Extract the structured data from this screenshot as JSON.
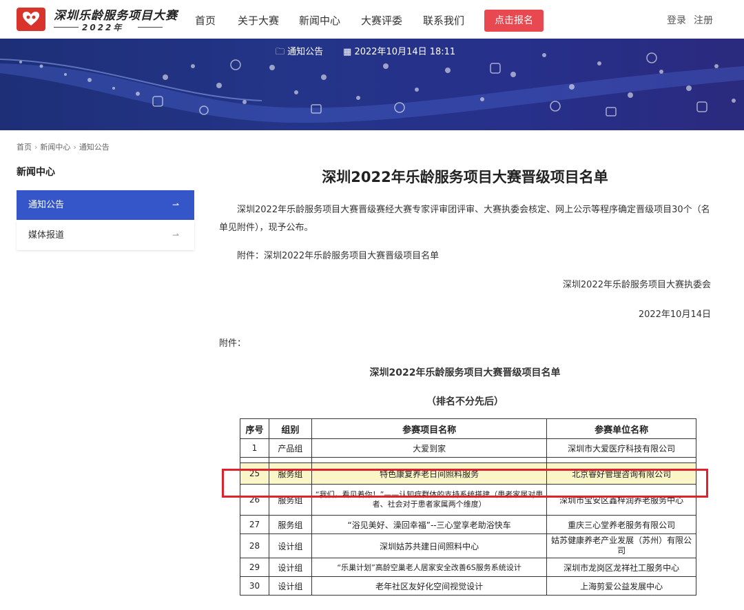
{
  "site": {
    "logo_title": "深圳乐龄服务项目大赛",
    "logo_year": "2022年"
  },
  "nav": {
    "items": [
      "首页",
      "关于大赛",
      "新闻中心",
      "大赛评委",
      "联系我们"
    ],
    "signup": "点击报名",
    "login": "登录",
    "register": "注册"
  },
  "banner": {
    "category": "通知公告",
    "datetime": "2022年10月14日 18:11"
  },
  "breadcrumb": [
    "首页",
    "新闻中心",
    "通知公告"
  ],
  "sidebar": {
    "title": "新闻中心",
    "items": [
      {
        "label": "通知公告",
        "arrow": "⇀"
      },
      {
        "label": "媒体报道",
        "arrow": "⇀"
      }
    ]
  },
  "article": {
    "title": "深圳2022年乐龄服务项目大赛晋级项目名单",
    "para1": "深圳2022年乐龄服务项目大赛晋级赛经大赛专家评审团评审、大赛执委会核定、网上公示等程序确定晋级项目30个（名单见附件），现予公布。",
    "attach_line": "附件：深圳2022年乐龄服务项目大赛晋级项目名单",
    "signature": "深圳2022年乐龄服务项目大赛执委会",
    "date": "2022年10月14日",
    "attach_label": "附件：",
    "list_title": "深圳2022年乐龄服务项目大赛晋级项目名单",
    "list_sub": "（排名不分先后）"
  },
  "table": {
    "headers": [
      "序号",
      "组别",
      "参赛项目名称",
      "参赛单位名称"
    ],
    "rows": [
      [
        "1",
        "产品组",
        "大爱到家",
        "深圳市大爱医疗科技有限公司"
      ],
      [
        "25",
        "服务组",
        "特色康复养老日间照料服务",
        "北京睿好管理咨询有限公司"
      ],
      [
        "26",
        "服务组",
        "“我们，看见着你！”——认知症群体的支持系统搭建（患者家属对患者、社会对于患者家属两个维度）",
        "深圳市宝安区鑫梓润养老服务中心"
      ],
      [
        "27",
        "服务组",
        "“浴见美好、澡回幸福”--三心堂享老助浴快车",
        "重庆三心堂养老服务有限公司"
      ],
      [
        "28",
        "设计组",
        "深圳姑苏共建日间照料中心",
        "姑苏健康养老产业发展（苏州）有限公司"
      ],
      [
        "29",
        "设计组",
        "“乐巢计划”高龄空巢老人居家安全改善6S服务系统设计",
        "深圳市龙岗区龙祥社工服务中心"
      ],
      [
        "30",
        "设计组",
        "老年社区友好化空间视觉设计",
        "上海剪爱公益发展中心"
      ]
    ]
  },
  "colors": {
    "brand_red": "#d8342c",
    "signup_red": "#e8484f",
    "sidebar_active": "#3556c8",
    "banner": "#243488",
    "highlight_box": "#e0202a"
  },
  "icons": [
    "logo-heart-icon",
    "document-icon",
    "calendar-icon",
    "arrow-right-icon"
  ]
}
